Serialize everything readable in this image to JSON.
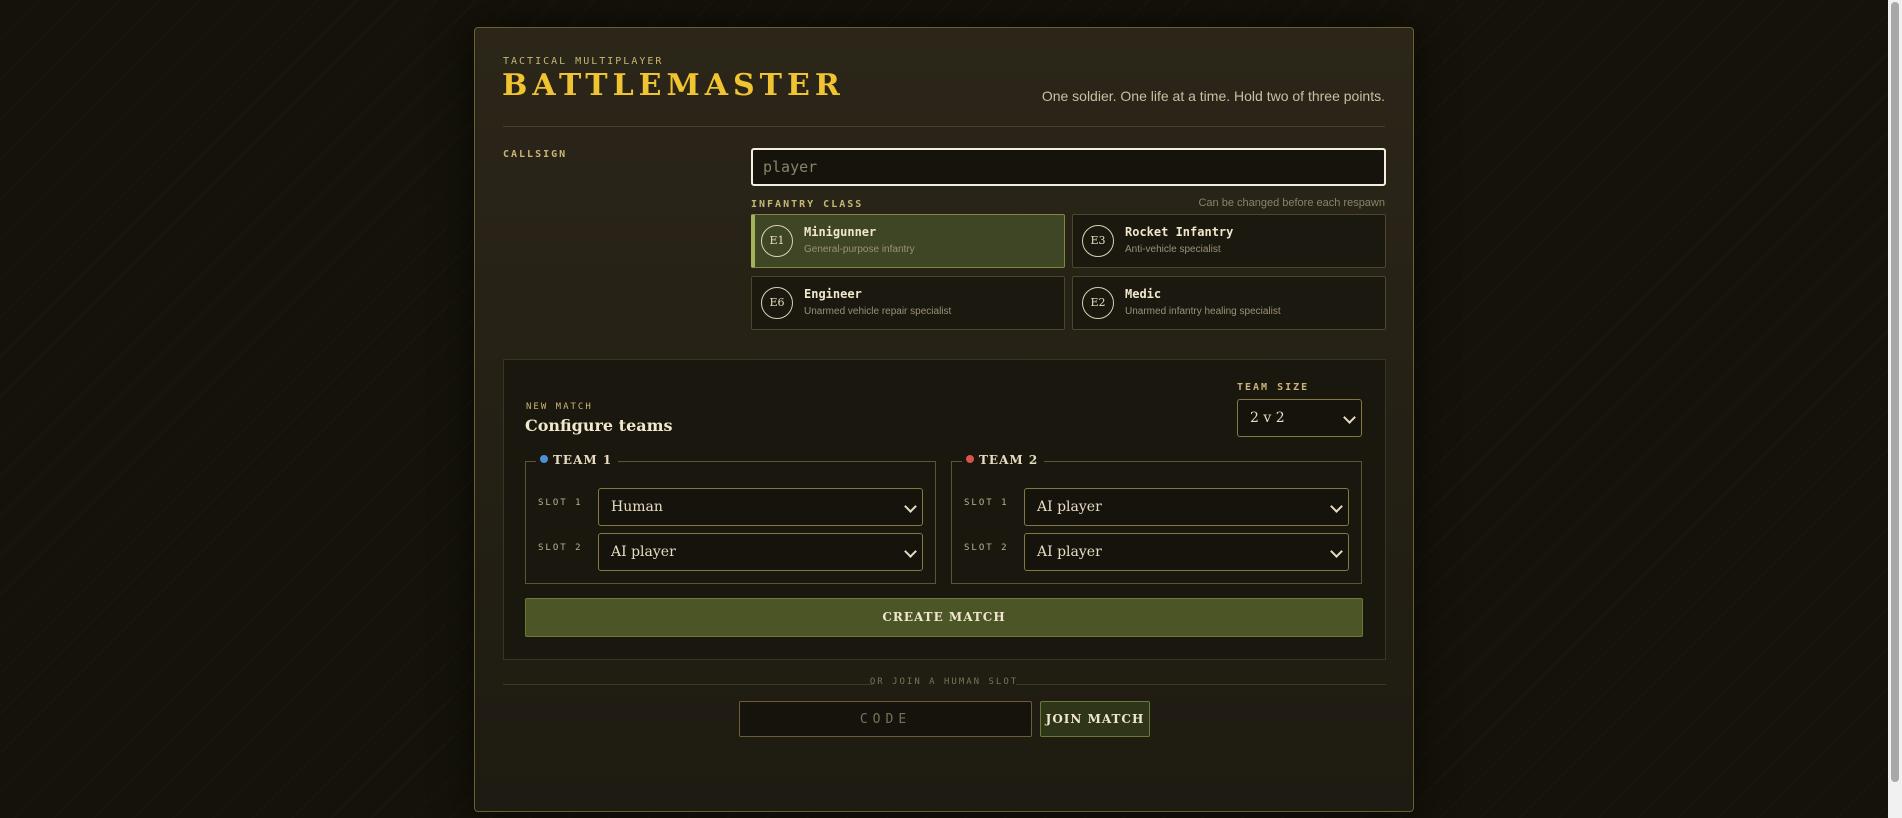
{
  "header": {
    "eyebrow": "TACTICAL MULTIPLAYER",
    "title": "BATTLEMASTER",
    "tagline": "One soldier. One life at a time. Hold two of three points."
  },
  "callsign": {
    "label": "CALLSIGN",
    "value": "",
    "placeholder": "player"
  },
  "infantry": {
    "label": "INFANTRY CLASS",
    "hint": "Can be changed before each respawn",
    "selected": "Minigunner",
    "classes": [
      {
        "code": "E1",
        "name": "Minigunner",
        "desc": "General-purpose infantry"
      },
      {
        "code": "E3",
        "name": "Rocket Infantry",
        "desc": "Anti-vehicle specialist"
      },
      {
        "code": "E6",
        "name": "Engineer",
        "desc": "Unarmed vehicle repair specialist"
      },
      {
        "code": "E2",
        "name": "Medic",
        "desc": "Unarmed infantry healing specialist"
      }
    ]
  },
  "match": {
    "eyebrow": "NEW MATCH",
    "title": "Configure teams",
    "team_size_label": "TEAM SIZE",
    "team_size_value": "2 v 2",
    "teams": [
      {
        "name": "TEAM 1",
        "color": "#4a90d9",
        "slots": [
          {
            "label": "SLOT 1",
            "value": "Human"
          },
          {
            "label": "SLOT 2",
            "value": "AI player"
          }
        ]
      },
      {
        "name": "TEAM 2",
        "color": "#d9534a",
        "slots": [
          {
            "label": "SLOT 1",
            "value": "AI player"
          },
          {
            "label": "SLOT 2",
            "value": "AI player"
          }
        ]
      }
    ],
    "create_label": "CREATE MATCH"
  },
  "join": {
    "divider_text": "OR JOIN A HUMAN SLOT",
    "code_placeholder": "CODE",
    "join_label": "JOIN MATCH"
  },
  "icons": {
    "select_arrow": "chevron-down-icon",
    "team_marker": "dot-icon"
  },
  "colors": {
    "accent": "#f0c330",
    "selected_class": "#3e4625",
    "create_button": "#4b5526"
  }
}
